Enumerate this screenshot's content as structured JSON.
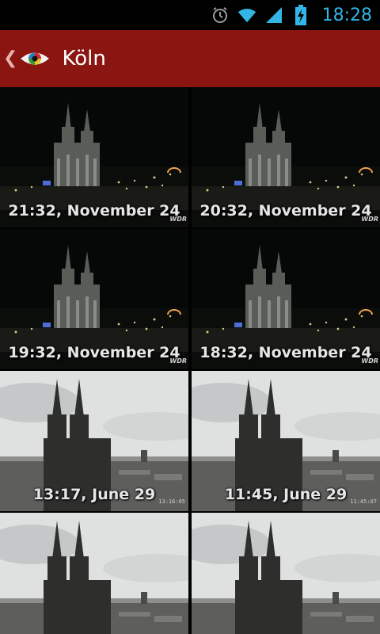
{
  "status_bar": {
    "time": "18:28",
    "icons": [
      "alarm-icon",
      "wifi-icon",
      "signal-icon",
      "battery-charging-icon"
    ],
    "time_color": "#33b5e5"
  },
  "action_bar": {
    "title": "Köln",
    "background": "#8a1511",
    "logo": "eye-logo-icon"
  },
  "webcam_tiles": [
    {
      "caption": "21:32, November 24",
      "scene": "night",
      "watermark": "WDR",
      "stamp": ""
    },
    {
      "caption": "20:32, November 24",
      "scene": "night",
      "watermark": "WDR",
      "stamp": ""
    },
    {
      "caption": "19:32, November 24",
      "scene": "night",
      "watermark": "WDR",
      "stamp": ""
    },
    {
      "caption": "18:32, November 24",
      "scene": "night",
      "watermark": "WDR",
      "stamp": ""
    },
    {
      "caption": "13:17, June 29",
      "scene": "day",
      "watermark": "",
      "stamp": "13:16:05"
    },
    {
      "caption": "11:45, June 29",
      "scene": "day",
      "watermark": "",
      "stamp": "11:45:07"
    },
    {
      "caption": "",
      "scene": "day",
      "watermark": "",
      "stamp": ""
    },
    {
      "caption": "",
      "scene": "day",
      "watermark": "",
      "stamp": ""
    }
  ]
}
